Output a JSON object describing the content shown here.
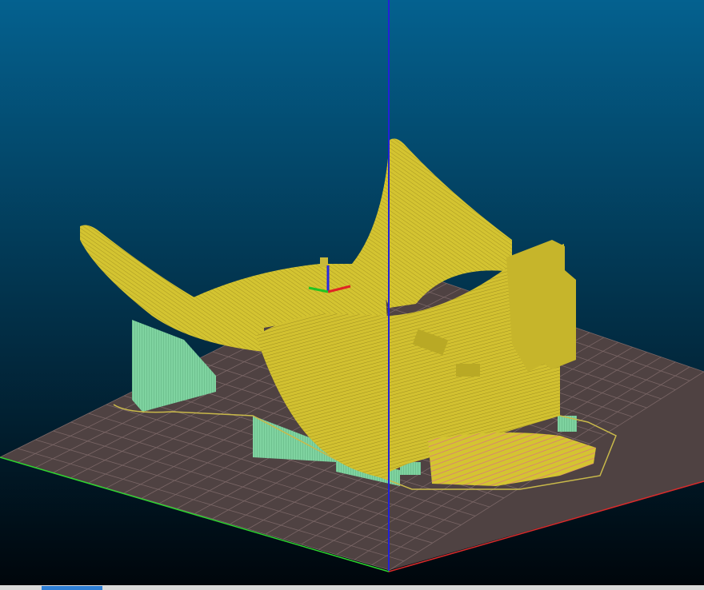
{
  "viewport": {
    "scene": "sliced-model-layer-preview",
    "background_top_color": "#04618f",
    "background_bottom_color": "#00050a",
    "bed_color": "#4f4242",
    "bed_grid_color": "#7a6666",
    "model_color": "#d4c431",
    "model_shadow_color": "#a89722",
    "support_color": "#7fd3a0",
    "x_axis_color": "#d92b2b",
    "y_axis_color": "#2ed42e",
    "z_axis_color": "#2222d8",
    "skirt_color": "#c9b94a",
    "infill_color": "#d98a6a"
  },
  "gizmo": {
    "icon": "axes-gizmo-icon",
    "x_color": "#e02424",
    "y_color": "#22c422",
    "z_color": "#2828e0"
  },
  "scrollbar": {
    "track_color": "#d9d9d9",
    "thumb_color": "#2f7fd6"
  }
}
